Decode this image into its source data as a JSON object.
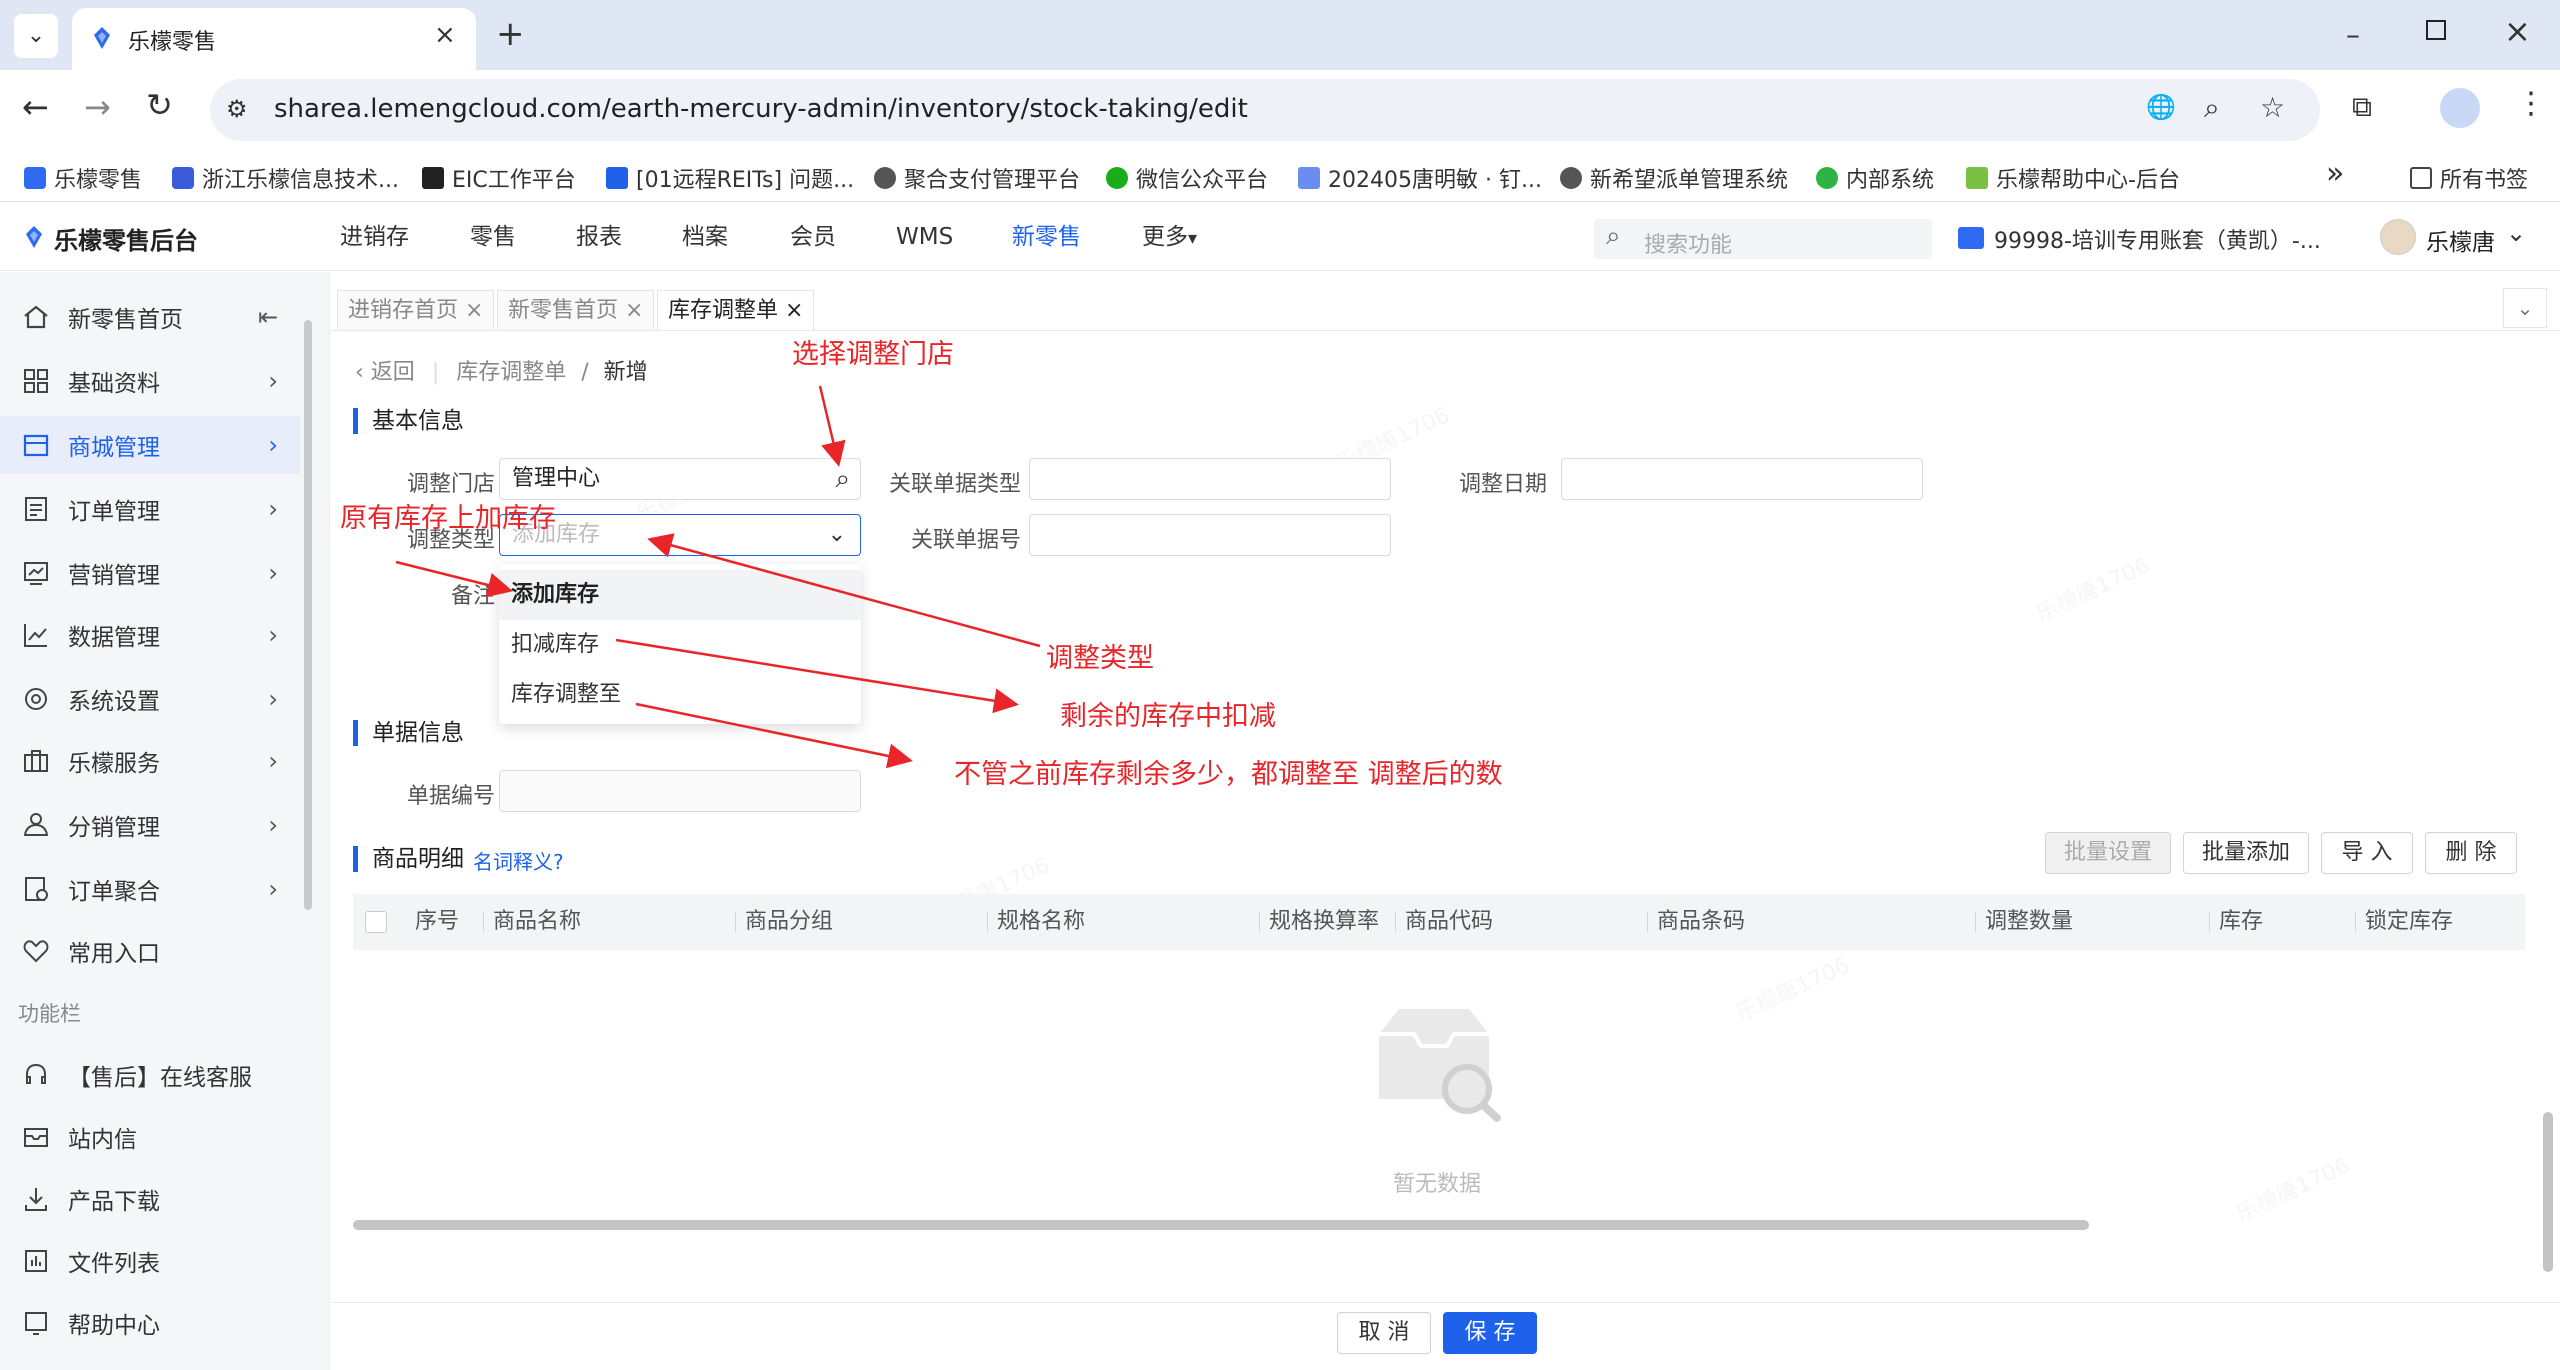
{
  "browser": {
    "tab_title": "乐檬零售",
    "url": "sharea.lemengcloud.com/earth-mercury-admin/inventory/stock-taking/edit",
    "bookmarks": [
      "乐檬零售",
      "浙江乐檬信息技术...",
      "EIC工作平台",
      "[01远程REITs] 问题...",
      "聚合支付管理平台",
      "微信公众平台",
      "202405唐明敏 · 钉...",
      "新希望派单管理系统",
      "内部系统",
      "乐檬帮助中心-后台"
    ],
    "all_bookmarks": "所有书签",
    "more_bookmarks": "»"
  },
  "header": {
    "logo": "乐檬零售后台",
    "nav": [
      "进销存",
      "零售",
      "报表",
      "档案",
      "会员",
      "WMS",
      "新零售",
      "更多"
    ],
    "more_caret": "▾",
    "search_placeholder": "搜索功能",
    "account": "99998-培训专用账套（黄凯）-...",
    "user": "乐檬唐"
  },
  "sidebar": {
    "items": [
      {
        "label": "新零售首页",
        "icon": "home-icon"
      },
      {
        "label": "基础资料",
        "icon": "grid-icon"
      },
      {
        "label": "商城管理",
        "icon": "store-icon"
      },
      {
        "label": "订单管理",
        "icon": "order-icon"
      },
      {
        "label": "营销管理",
        "icon": "marketing-icon"
      },
      {
        "label": "数据管理",
        "icon": "chart-icon"
      },
      {
        "label": "系统设置",
        "icon": "settings-icon"
      },
      {
        "label": "乐檬服务",
        "icon": "service-icon"
      },
      {
        "label": "分销管理",
        "icon": "distribution-icon"
      },
      {
        "label": "订单聚合",
        "icon": "aggregate-icon"
      },
      {
        "label": "常用入口",
        "icon": "heart-icon"
      }
    ],
    "tools_title": "功能栏",
    "tools": [
      {
        "label": "【售后】在线客服",
        "icon": "headset-icon"
      },
      {
        "label": "站内信",
        "icon": "mail-icon"
      },
      {
        "label": "产品下载",
        "icon": "download-icon"
      },
      {
        "label": "文件列表",
        "icon": "file-list-icon"
      },
      {
        "label": "帮助中心",
        "icon": "help-icon"
      }
    ]
  },
  "page_tabs": [
    "进销存首页",
    "新零售首页",
    "库存调整单"
  ],
  "breadcrumb": {
    "back": "返回",
    "parent": "库存调整单",
    "sep": "/",
    "current": "新增"
  },
  "basic_info": {
    "title": "基本信息",
    "store_label": "调整门店",
    "store_value": "管理中心",
    "related_type_label": "关联单据类型",
    "date_label": "调整日期",
    "adjust_type_label": "调整类型",
    "adjust_type_placeholder": "添加库存",
    "related_no_label": "关联单据号",
    "remark_label": "备注"
  },
  "dropdown_options": [
    "添加库存",
    "扣减库存",
    "库存调整至"
  ],
  "doc_info": {
    "title": "单据信息",
    "doc_no_label": "单据编号"
  },
  "items_section": {
    "title": "商品明细",
    "help_link": "名词释义?",
    "buttons": [
      "批量设置",
      "批量添加",
      "导 入",
      "删 除"
    ],
    "columns": [
      "序号",
      "商品名称",
      "商品分组",
      "规格名称",
      "规格换算率",
      "商品代码",
      "商品条码",
      "调整数量",
      "库存",
      "锁定库存"
    ],
    "empty_text": "暂无数据"
  },
  "footer": {
    "cancel": "取 消",
    "save": "保 存"
  },
  "annotations": {
    "select_store": "选择调整门店",
    "add_on_original": "原有库存上加库存",
    "adjust_type": "调整类型",
    "deduct": "剩余的库存中扣减",
    "adjust_to": "不管之前库存剩余多少，都调整至 调整后的数"
  },
  "watermark": "乐檬唐1706",
  "colors": {
    "primary": "#1e62ec",
    "annotation": "#e8262a"
  }
}
